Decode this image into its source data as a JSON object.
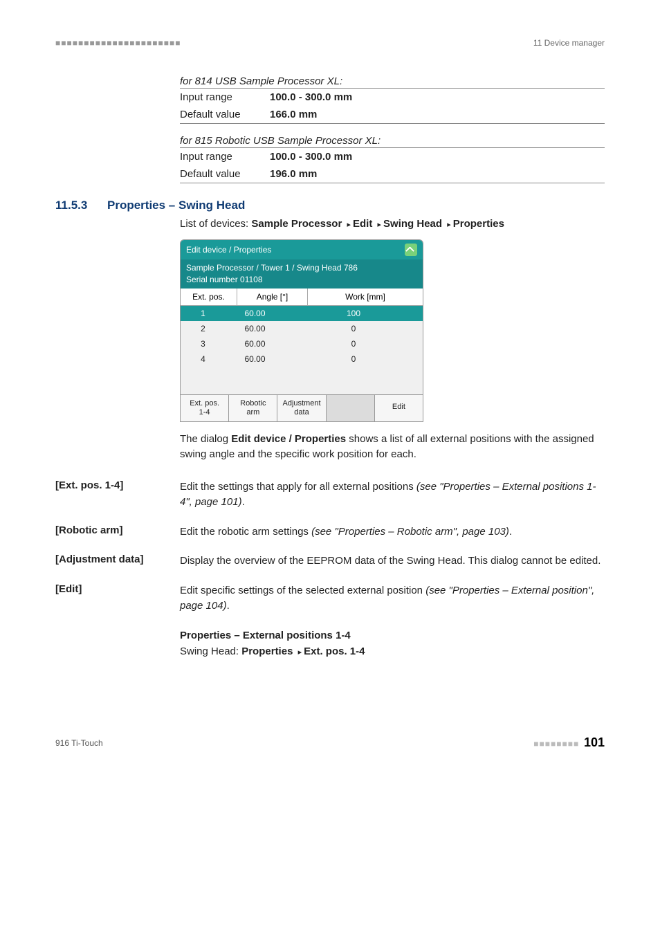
{
  "header_right": "11 Device manager",
  "xl814": {
    "caption": "for 814 USB Sample Processor XL:",
    "rows": [
      {
        "k": "Input range",
        "v": "100.0 - 300.0 mm"
      },
      {
        "k": "Default value",
        "v": "166.0 mm"
      }
    ]
  },
  "xl815": {
    "caption": "for 815 Robotic USB Sample Processor XL:",
    "rows": [
      {
        "k": "Input range",
        "v": "100.0 - 300.0 mm"
      },
      {
        "k": "Default value",
        "v": "196.0 mm"
      }
    ]
  },
  "section": {
    "num": "11.5.3",
    "title": "Properties – Swing Head"
  },
  "breadcrumb_prefix": "List of devices: ",
  "breadcrumb": [
    "Sample Processor",
    "Edit",
    "Swing Head",
    "Properties"
  ],
  "screenshot": {
    "title": "Edit device / Properties",
    "sub1": "Sample Processor / Tower 1 / Swing Head 786",
    "sub2": "Serial number 01108",
    "cols": [
      "Ext. pos.",
      "Angle [°]",
      "Work [mm]"
    ],
    "rows": [
      {
        "p": "1",
        "a": "60.00",
        "w": "100"
      },
      {
        "p": "2",
        "a": "60.00",
        "w": "0"
      },
      {
        "p": "3",
        "a": "60.00",
        "w": "0"
      },
      {
        "p": "4",
        "a": "60.00",
        "w": "0"
      }
    ],
    "btns": [
      "Ext. pos.\n1-4",
      "Robotic\narm",
      "Adjustment\ndata",
      "",
      "Edit"
    ]
  },
  "intro_a": "The dialog ",
  "intro_b": "Edit device / Properties",
  "intro_c": " shows a list of all external positions with the assigned swing angle and the specific work position for each.",
  "items": [
    {
      "label": "[Ext. pos. 1-4]",
      "plain": "Edit the settings that apply for all external positions ",
      "ital": "(see \"Properties – External positions 1-4\", page 101)",
      "suffix": "."
    },
    {
      "label": "[Robotic arm]",
      "plain": "Edit the robotic arm settings ",
      "ital": "(see \"Properties – Robotic arm\", page 103)",
      "suffix": "."
    },
    {
      "label": "[Adjustment data]",
      "plain": "Display the overview of the EEPROM data of the Swing Head. This dialog cannot be edited.",
      "ital": "",
      "suffix": ""
    },
    {
      "label": "[Edit]",
      "plain": "Edit specific settings of the selected external position ",
      "ital": "(see \"Properties – External position\", page 104)",
      "suffix": "."
    }
  ],
  "subhead": "Properties – External positions 1-4",
  "nav2_prefix": "Swing Head: ",
  "nav2": [
    "Properties",
    "Ext. pos. 1-4"
  ],
  "footer_left": "916 Ti-Touch",
  "page_num": "101"
}
